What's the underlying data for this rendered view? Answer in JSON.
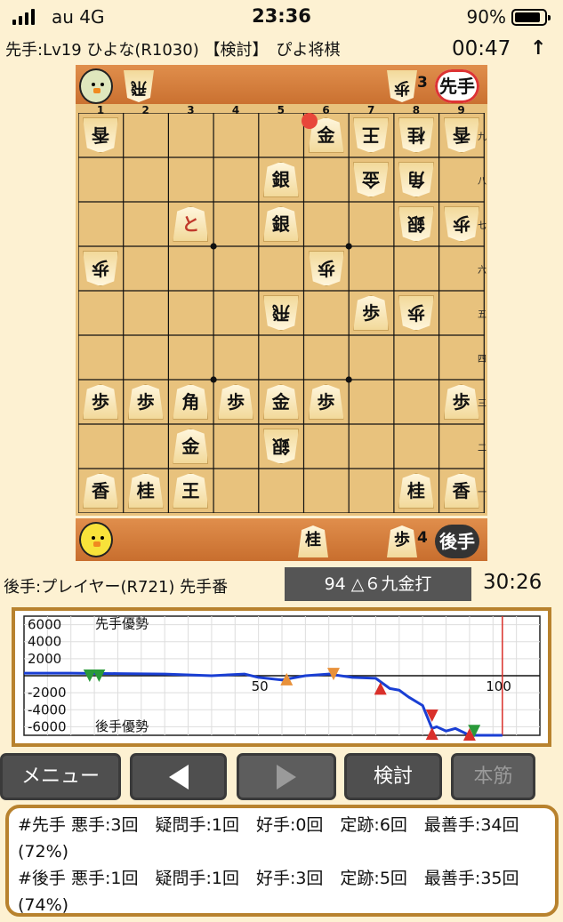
{
  "status_bar": {
    "carrier": "au  4G",
    "time": "23:36",
    "battery": "90%"
  },
  "header": {
    "game_info": "先手:Lv19 ひよな(R1030) 【検討】　ぴよ将棋",
    "elapsed": "00:47",
    "arrow": "↑"
  },
  "top_player": {
    "badge": "先手",
    "hand": [
      {
        "piece": "飛",
        "count": ""
      },
      {
        "piece": "歩",
        "count": "3"
      }
    ]
  },
  "bottom_player": {
    "badge": "後手",
    "hand": [
      {
        "piece": "桂",
        "count": ""
      },
      {
        "piece": "歩",
        "count": "4"
      }
    ]
  },
  "board": {
    "col_labels": [
      "1",
      "2",
      "3",
      "4",
      "5",
      "6",
      "7",
      "8",
      "9"
    ],
    "row_labels": [
      "九",
      "八",
      "七",
      "六",
      "五",
      "四",
      "三",
      "二",
      "一"
    ],
    "pieces": [
      {
        "c": 0,
        "r": 0,
        "p": "香",
        "g": true
      },
      {
        "c": 5,
        "r": 0,
        "p": "金",
        "g": false
      },
      {
        "c": 6,
        "r": 0,
        "p": "王",
        "g": true
      },
      {
        "c": 7,
        "r": 0,
        "p": "桂",
        "g": true
      },
      {
        "c": 8,
        "r": 0,
        "p": "香",
        "g": true
      },
      {
        "c": 4,
        "r": 1,
        "p": "銀",
        "g": false
      },
      {
        "c": 6,
        "r": 1,
        "p": "金",
        "g": true
      },
      {
        "c": 7,
        "r": 1,
        "p": "角",
        "g": true
      },
      {
        "c": 2,
        "r": 2,
        "p": "と",
        "g": false,
        "red": true
      },
      {
        "c": 4,
        "r": 2,
        "p": "銀",
        "g": false
      },
      {
        "c": 7,
        "r": 2,
        "p": "銀",
        "g": true
      },
      {
        "c": 8,
        "r": 2,
        "p": "歩",
        "g": true
      },
      {
        "c": 0,
        "r": 3,
        "p": "歩",
        "g": true
      },
      {
        "c": 5,
        "r": 3,
        "p": "歩",
        "g": true
      },
      {
        "c": 4,
        "r": 4,
        "p": "飛",
        "g": true
      },
      {
        "c": 6,
        "r": 4,
        "p": "歩",
        "g": false
      },
      {
        "c": 7,
        "r": 4,
        "p": "歩",
        "g": true
      },
      {
        "c": 0,
        "r": 6,
        "p": "歩",
        "g": false
      },
      {
        "c": 1,
        "r": 6,
        "p": "歩",
        "g": false
      },
      {
        "c": 2,
        "r": 6,
        "p": "角",
        "g": false
      },
      {
        "c": 3,
        "r": 6,
        "p": "歩",
        "g": false
      },
      {
        "c": 4,
        "r": 6,
        "p": "金",
        "g": false
      },
      {
        "c": 5,
        "r": 6,
        "p": "歩",
        "g": false
      },
      {
        "c": 8,
        "r": 6,
        "p": "歩",
        "g": false
      },
      {
        "c": 2,
        "r": 7,
        "p": "金",
        "g": false
      },
      {
        "c": 4,
        "r": 7,
        "p": "銀",
        "g": true
      },
      {
        "c": 0,
        "r": 8,
        "p": "香",
        "g": false
      },
      {
        "c": 1,
        "r": 8,
        "p": "桂",
        "g": false
      },
      {
        "c": 2,
        "r": 8,
        "p": "王",
        "g": false
      },
      {
        "c": 7,
        "r": 8,
        "p": "桂",
        "g": false
      },
      {
        "c": 8,
        "r": 8,
        "p": "香",
        "g": false
      }
    ]
  },
  "turn_info": "後手:プレイヤー(R721) 先手番",
  "last_move": "94 △６九金打",
  "timer": "30:26",
  "chart_data": {
    "type": "line",
    "y_tick_labels": [
      "6000",
      "4000",
      "2000",
      "-2000",
      "-4000",
      "-6000"
    ],
    "x_tick_labels": [
      "50",
      "100"
    ],
    "annotations": [
      "先手優勢",
      "後手優勢"
    ],
    "ylim": [
      -7000,
      7000
    ],
    "xlim": [
      0,
      110
    ],
    "x": [
      0,
      10,
      20,
      30,
      40,
      47,
      50,
      55,
      60,
      65,
      70,
      75,
      78,
      80,
      82,
      85,
      87,
      88,
      90,
      92,
      95,
      100,
      102
    ],
    "values": [
      300,
      300,
      250,
      200,
      0,
      200,
      -200,
      -500,
      0,
      200,
      -200,
      -300,
      -1500,
      -1700,
      -2500,
      -3500,
      -6200,
      -6000,
      -6500,
      -6200,
      -7000,
      -7000,
      -7000
    ],
    "current_move": 102,
    "line_color": "#1a3fd4",
    "markers": [
      {
        "x": 14,
        "y": 0,
        "color": "#2a9a3a",
        "shape": "down"
      },
      {
        "x": 16,
        "y": 0,
        "color": "#2a9a3a",
        "shape": "down"
      },
      {
        "x": 66,
        "y": 200,
        "color": "#e8913a",
        "shape": "down"
      },
      {
        "x": 56,
        "y": -400,
        "color": "#e8913a",
        "shape": "up"
      },
      {
        "x": 76,
        "y": -1500,
        "color": "#d9302a",
        "shape": "up"
      },
      {
        "x": 87,
        "y": -4700,
        "color": "#d9302a",
        "shape": "down"
      },
      {
        "x": 87,
        "y": -6800,
        "color": "#d9302a",
        "shape": "up"
      },
      {
        "x": 96,
        "y": -6500,
        "color": "#2a9a3a",
        "shape": "down"
      },
      {
        "x": 95,
        "y": -6900,
        "color": "#d9302a",
        "shape": "up"
      }
    ]
  },
  "buttons": {
    "menu": "メニュー",
    "kentou": "検討",
    "honsuji": "本筋"
  },
  "summary": {
    "sente": "#先手 悪手:3回　疑問手:1回　好手:0回　定跡:6回　最善手:34回(72%)",
    "gote": "#後手 悪手:1回　疑問手:1回　好手:3回　定跡:5回　最善手:35回(74%)"
  }
}
